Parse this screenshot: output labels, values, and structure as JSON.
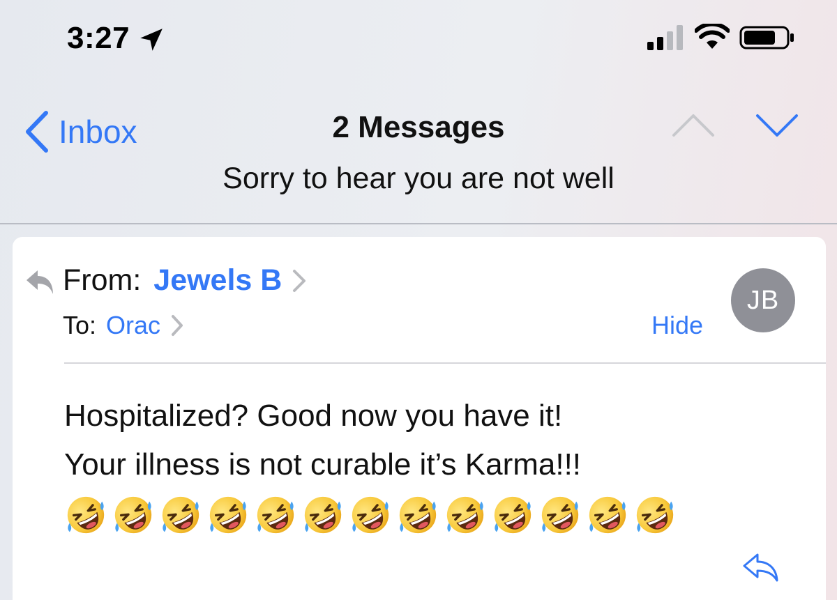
{
  "status_bar": {
    "time": "3:27",
    "icons": [
      "location-arrow-icon",
      "signal-bars-icon",
      "wifi-icon",
      "battery-icon"
    ]
  },
  "nav": {
    "back_label": "Inbox",
    "title": "2 Messages",
    "up_icon": "chevron-up-icon",
    "down_icon": "chevron-down-icon"
  },
  "subject": "Sorry to hear you are not well",
  "message": {
    "from_label": "From:",
    "from_name": "Jewels B",
    "to_label": "To:",
    "to_name": "Orac",
    "hide_label": "Hide",
    "avatar_initials": "JB",
    "body_lines": [
      "Hospitalized? Good now you have it!",
      "Your illness is not curable it’s Karma!!!"
    ],
    "emoji": "rolling-on-the-floor-laughing",
    "emoji_count": 13
  },
  "colors": {
    "accent": "#3478f6",
    "avatar_bg": "#8f9097",
    "disabled_chevron": "#c7c8cc"
  }
}
